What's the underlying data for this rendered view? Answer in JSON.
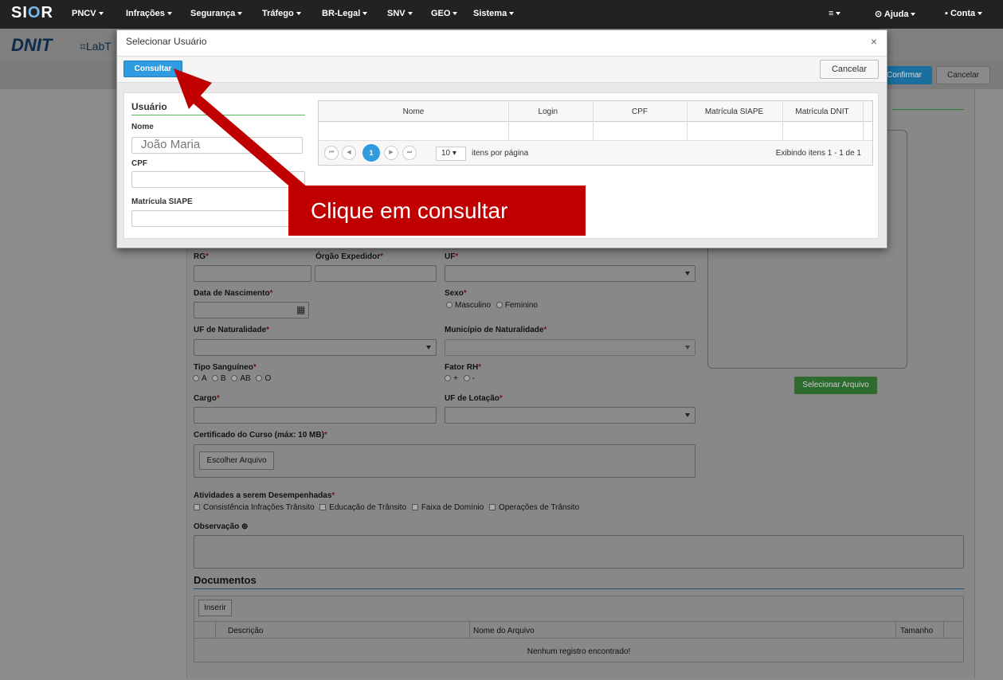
{
  "navbar": {
    "brand": "SIOR",
    "items": [
      "PNCV",
      "Infrações",
      "Segurança",
      "Tráfego",
      "BR-Legal",
      "SNV",
      "GEO",
      "Sistema"
    ],
    "menu_icon": "menu-list-icon",
    "help": "Ajuda",
    "account": "Conta"
  },
  "header": {
    "logo": "DNIT",
    "lab": "LabT"
  },
  "page_toolbar": {
    "confirm": "Confirmar",
    "cancel": "Cancelar"
  },
  "form": {
    "rg": "RG",
    "orgao": "Órgão Expedidor",
    "uf": "UF",
    "data_nasc": "Data de Nascimento",
    "sexo": "Sexo",
    "sexo_options": [
      "Masculino",
      "Feminino"
    ],
    "uf_nat": "UF de Naturalidade",
    "mun_nat": "Município de Naturalidade",
    "tipo_sang": "Tipo Sanguíneo",
    "tipo_sang_options": [
      "A",
      "B",
      "AB",
      "O"
    ],
    "fator_rh": "Fator RH",
    "fator_rh_options": [
      "+",
      "-"
    ],
    "cargo": "Cargo",
    "uf_lot": "UF de Lotação",
    "certificado": "Certificado do Curso (máx: 10 MB)",
    "escolher": "Escolher Arquivo",
    "atividades": "Atividades a serem Desempenhadas",
    "atividades_options": [
      "Consistência Infrações Trânsito",
      "Educação de Trânsito",
      "Faixa de Domínio",
      "Operações de Trânsito"
    ],
    "observacao": "Observação",
    "selecionar_arquivo": "Selecionar Arquivo",
    "required_mark": "*"
  },
  "documentos": {
    "title": "Documentos",
    "inserir": "Inserir",
    "columns": [
      "Descrição",
      "Nome do Arquivo",
      "Tamanho"
    ],
    "empty": "Nenhum registro encontrado!"
  },
  "modal": {
    "title": "Selecionar Usuário",
    "close": "×",
    "consultar": "Consultar",
    "cancelar": "Cancelar",
    "section": "Usuário",
    "nome_label": "Nome",
    "nome_value": "João Maria",
    "cpf_label": "CPF",
    "matricula_label": "Matrícula SIAPE",
    "grid_columns": [
      "Nome",
      "Login",
      "CPF",
      "Matrícula SIAPE",
      "Matrícula DNIT"
    ],
    "pager": {
      "first": "⏮",
      "prev": "◀",
      "current": "1",
      "next": "▶",
      "last": "⏭",
      "page_size": "10",
      "page_size_label": "itens por página",
      "info": "Exibindo itens 1 - 1 de 1"
    }
  },
  "annotation": {
    "text": "Clique em consultar",
    "color": "#c00000"
  }
}
